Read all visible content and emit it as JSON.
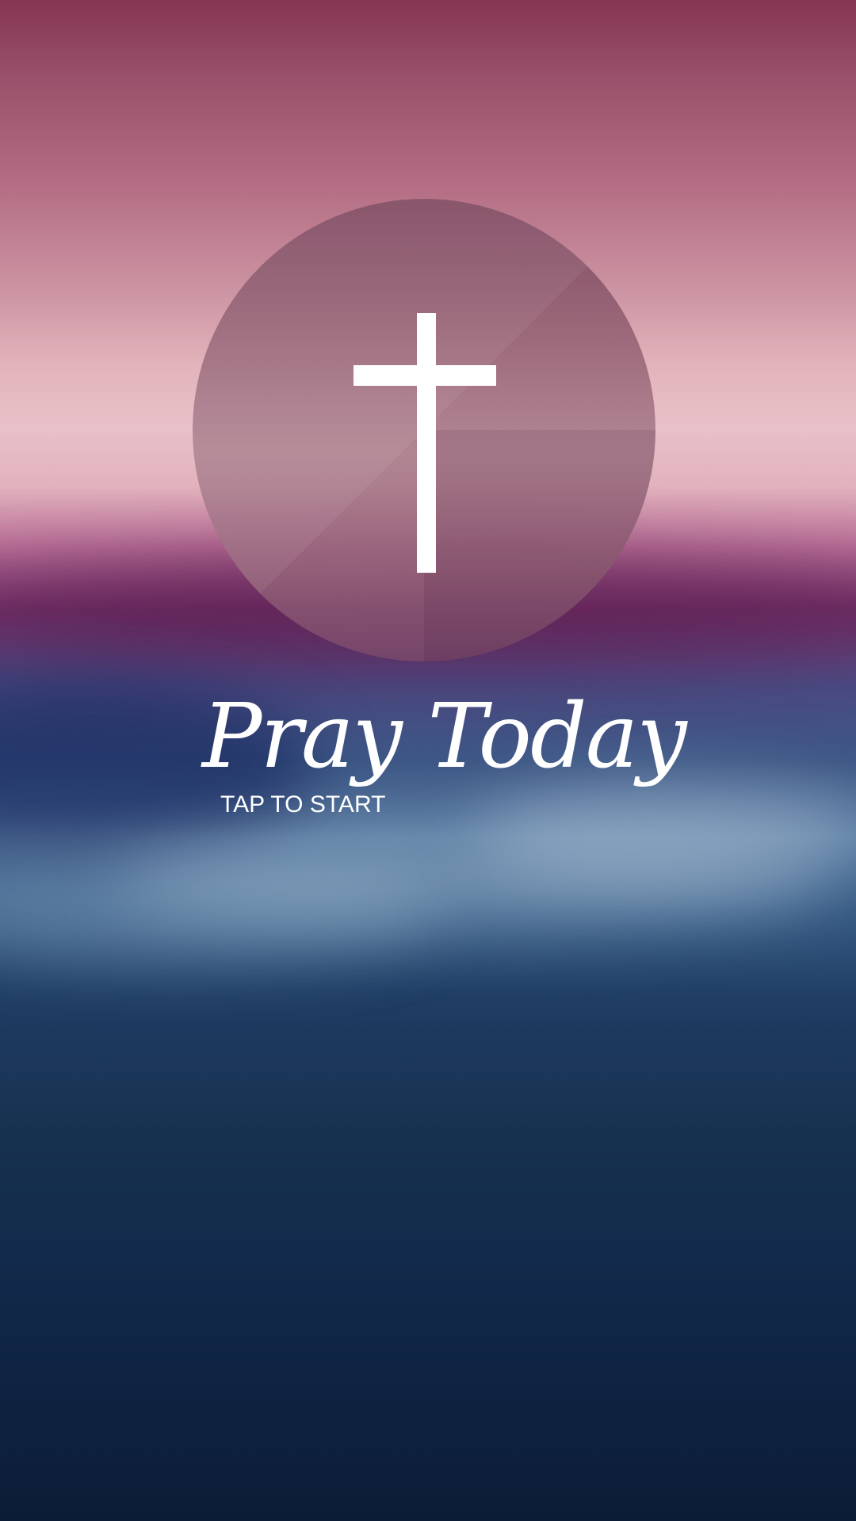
{
  "app": {
    "title": "Pray Today",
    "start_prompt": "TAP TO START"
  },
  "icons": {
    "emblem": "cross-icon"
  },
  "colors": {
    "sky_top": "#853553",
    "horizon_pink": "#e9c1c8",
    "water_blue": "#16304f",
    "bottom_navy": "#0b1c36",
    "emblem_circle": "#96647a",
    "foreground": "#ffffff"
  }
}
